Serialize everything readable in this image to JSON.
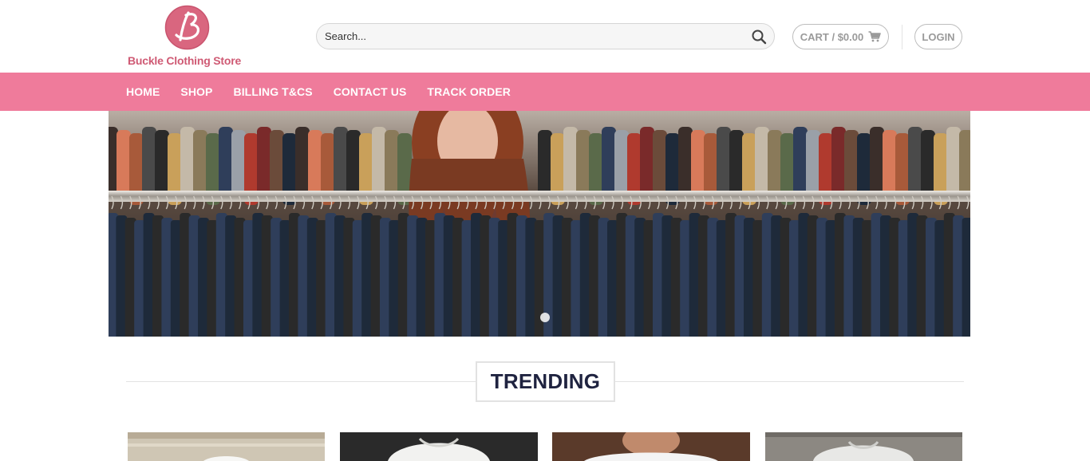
{
  "header": {
    "logo_text": "Buckle Clothing Store",
    "search": {
      "placeholder": "Search..."
    },
    "cart_label": "CART / $0.00",
    "login_label": "LOGIN"
  },
  "nav": {
    "items": [
      {
        "label": "HOME"
      },
      {
        "label": "SHOP"
      },
      {
        "label": "BILLING T&CS"
      },
      {
        "label": "CONTACT US"
      },
      {
        "label": "TRACK ORDER"
      }
    ]
  },
  "hero": {
    "slide_count": 1,
    "active_slide": 1
  },
  "trending": {
    "title": "TRENDING"
  },
  "colors": {
    "brand_pink": "#ef7b9b",
    "logo_pink": "#cf5a74",
    "heading_navy": "#1f2340"
  },
  "icons": [
    "search-icon",
    "cart-icon"
  ]
}
